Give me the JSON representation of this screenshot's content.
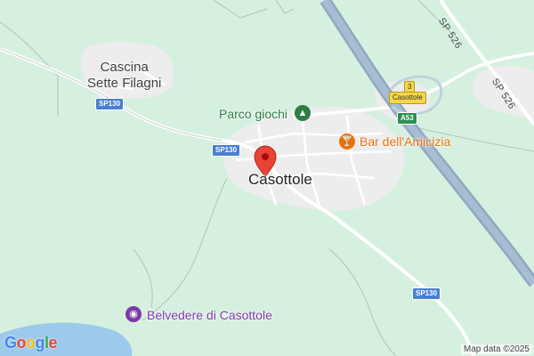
{
  "places": {
    "village_line1": "Cascina",
    "village_line2": "Sette Filagni",
    "town": "Casottole"
  },
  "pois": {
    "playground": "Parco giochi",
    "bar": "Bar dell'Amicizia",
    "viewpoint": "Belvedere di Casottole"
  },
  "roads": {
    "sp130_a": "SP130",
    "sp130_b": "SP130",
    "sp130_c": "SP130",
    "a53": "A53",
    "exit_number": "3",
    "exit_name": "Casottole",
    "sp526_a": "SP 526",
    "sp526_b": "SP 526"
  },
  "attribution": "Map data ©2025",
  "logo": [
    "G",
    "o",
    "o",
    "g",
    "l",
    "e"
  ],
  "colors": {
    "land": "#d6f0e0",
    "urban": "#eeeeee",
    "motorway": "#8fa8c2",
    "water": "#9dc9eb",
    "pin": "#ea4335",
    "poi_green": "#2e7d45",
    "poi_orange": "#e8710a",
    "poi_purple": "#7b3aa8"
  },
  "icons": {
    "playground": "tree-icon",
    "bar": "cocktail-icon",
    "viewpoint": "camera-icon",
    "pin": "map-pin-icon"
  }
}
